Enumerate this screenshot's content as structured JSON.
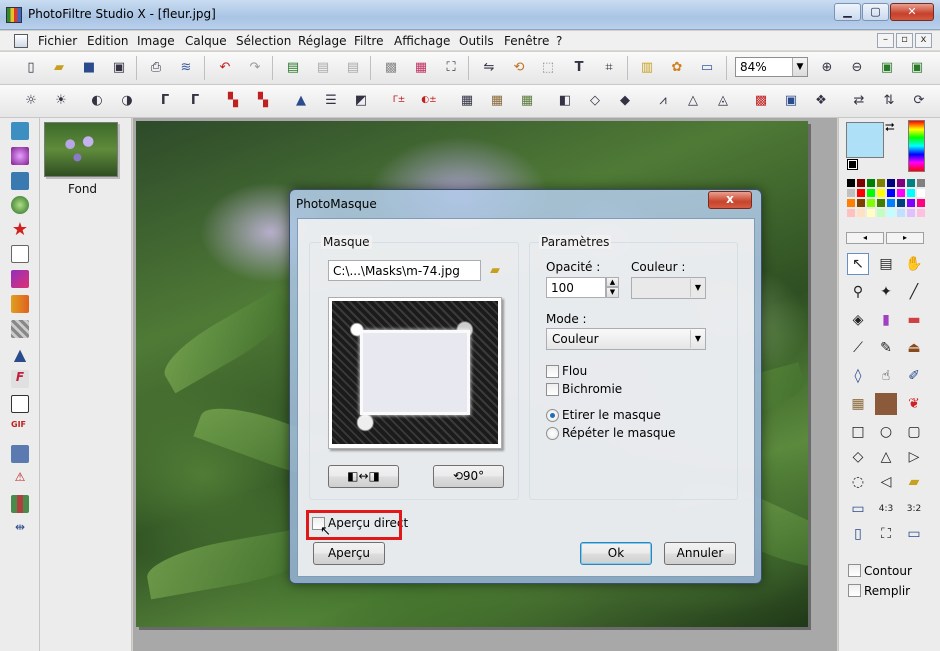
{
  "window": {
    "title": "PhotoFiltre Studio X - [fleur.jpg]",
    "minimize": "▁",
    "maximize": "▢",
    "close": "✕"
  },
  "menu": {
    "items": [
      "Fichier",
      "Edition",
      "Image",
      "Calque",
      "Sélection",
      "Réglage",
      "Filtre",
      "Affichage",
      "Outils",
      "Fenêtre",
      "?"
    ],
    "mdi_buttons": [
      "–",
      "▫",
      "x"
    ]
  },
  "toolbar": {
    "zoom": "84%"
  },
  "layers": {
    "label": "Fond"
  },
  "colors": {
    "foreground": "#aee0f7",
    "background": "#000000",
    "palette": [
      "#000000",
      "#800000",
      "#008000",
      "#808000",
      "#000080",
      "#800080",
      "#008080",
      "#808080",
      "#c0c0c0",
      "#ff0000",
      "#00ff00",
      "#ffff00",
      "#0000ff",
      "#ff00ff",
      "#00ffff",
      "#ffffff",
      "#ff8000",
      "#804000",
      "#80ff00",
      "#408000",
      "#0080ff",
      "#004080",
      "#8000ff",
      "#ff0080",
      "#ffc0c0",
      "#ffe0c0",
      "#ffffc0",
      "#c0ffc0",
      "#c0ffff",
      "#c0e0ff",
      "#e0c0ff",
      "#ffc0e0"
    ]
  },
  "right_panel": {
    "contour_label": "Contour",
    "remplir_label": "Remplir"
  },
  "dialog": {
    "title": "PhotoMasque",
    "close": "x",
    "masque": {
      "label": "Masque",
      "path": "C:\\...\\Masks\\m-74.jpg"
    },
    "parametres": {
      "label": "Paramètres",
      "opacite_label": "Opacité :",
      "opacite_value": "100",
      "couleur_label": "Couleur :",
      "mode_label": "Mode :",
      "mode_value": "Couleur",
      "flou_label": "Flou",
      "bichromie_label": "Bichromie",
      "etirer_label": "Etirer le masque",
      "repeter_label": "Répéter le masque"
    },
    "apercu_direct_label": "Aperçu direct",
    "apercu_button": "Aperçu",
    "ok_button": "Ok",
    "annuler_button": "Annuler"
  }
}
